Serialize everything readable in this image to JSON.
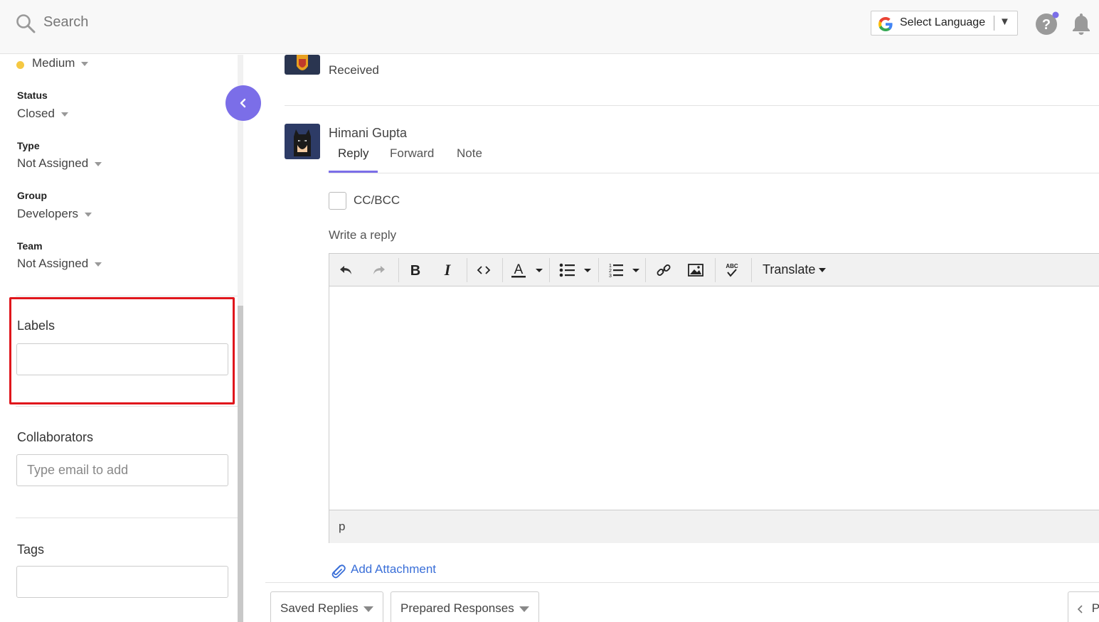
{
  "topbar": {
    "search_placeholder": "Search",
    "language_label": "Select Language",
    "language_arrow": "▼",
    "notification_dot_color": "#7b6ee8"
  },
  "sidebar": {
    "priority_value": "Medium",
    "priority_color": "#f5c842",
    "status": {
      "title": "Status",
      "value": "Closed"
    },
    "type": {
      "title": "Type",
      "value": "Not Assigned"
    },
    "group": {
      "title": "Group",
      "value": "Developers"
    },
    "team": {
      "title": "Team",
      "value": "Not Assigned"
    },
    "labels_title": "Labels",
    "labels_value": "",
    "collaborators_title": "Collaborators",
    "collaborators_placeholder": "Type email to add",
    "tags_title": "Tags",
    "tags_value": ""
  },
  "thread": {
    "previous_status": "Received",
    "author": "Himani Gupta",
    "tabs": [
      "Reply",
      "Forward",
      "Note"
    ],
    "active_tab": "Reply",
    "cc_label": "CC/BCC",
    "write_label": "Write a reply",
    "editor": {
      "translate_label": "Translate",
      "statusbar_text": "p",
      "body": ""
    },
    "add_attachment": "Add Attachment"
  },
  "footer": {
    "saved_replies": "Saved Replies",
    "prepared_responses": "Prepared Responses",
    "pager_text": "P"
  },
  "accent_color": "#7b6ee8",
  "highlight_color": "#e0161c",
  "link_color": "#3a6fd8"
}
